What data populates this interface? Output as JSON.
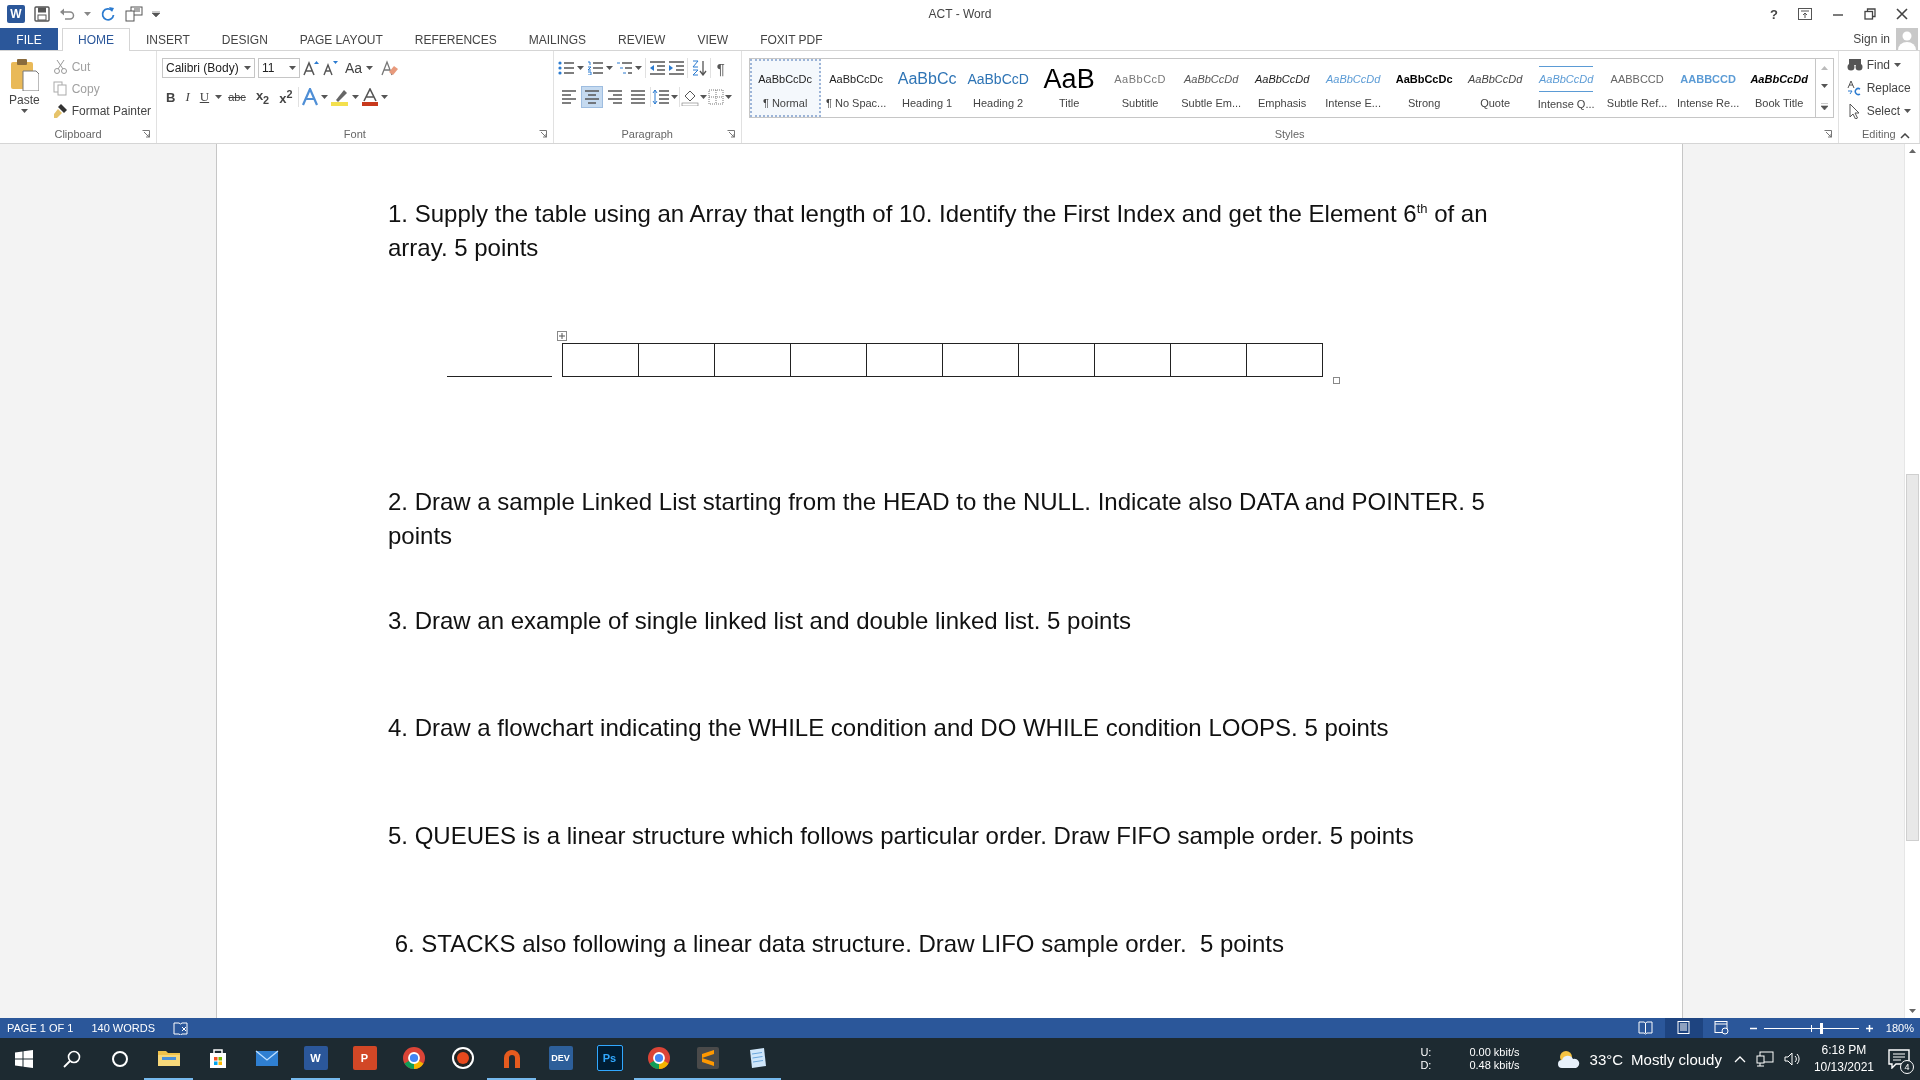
{
  "window": {
    "title": "ACT - Word",
    "app_letter": "W",
    "help": "?"
  },
  "ribbon_tabs": [
    {
      "label": "FILE",
      "kind": "file",
      "selected": false
    },
    {
      "label": "HOME",
      "kind": "tab",
      "selected": true
    },
    {
      "label": "INSERT",
      "kind": "tab",
      "selected": false
    },
    {
      "label": "DESIGN",
      "kind": "tab",
      "selected": false
    },
    {
      "label": "PAGE LAYOUT",
      "kind": "tab",
      "selected": false
    },
    {
      "label": "REFERENCES",
      "kind": "tab",
      "selected": false
    },
    {
      "label": "MAILINGS",
      "kind": "tab",
      "selected": false
    },
    {
      "label": "REVIEW",
      "kind": "tab",
      "selected": false
    },
    {
      "label": "VIEW",
      "kind": "tab",
      "selected": false
    },
    {
      "label": "FOXIT PDF",
      "kind": "tab",
      "selected": false
    }
  ],
  "account": {
    "label": "Sign in"
  },
  "clipboard": {
    "paste": "Paste",
    "group_label": "Clipboard",
    "items": [
      {
        "label": "Cut",
        "kind": "cut",
        "disabled": true
      },
      {
        "label": "Copy",
        "kind": "copy",
        "disabled": true
      },
      {
        "label": "Format Painter",
        "kind": "painter",
        "disabled": false
      }
    ]
  },
  "font": {
    "name": "Calibri (Body)",
    "size": "11",
    "case_button": "Aa",
    "group_label": "Font",
    "format_buttons": [
      {
        "label": "B",
        "kind": "bold"
      },
      {
        "label": "I",
        "kind": "italic"
      },
      {
        "label": "U",
        "kind": "underline"
      },
      {
        "label": "abc",
        "kind": "strike"
      },
      {
        "label": "x$_{2}$",
        "kind": "sub"
      },
      {
        "label": "x$^{2}$",
        "kind": "sup"
      }
    ]
  },
  "paragraph": {
    "marks_button": "¶",
    "group_label": "Paragraph",
    "alignments": [
      {
        "kind": "left",
        "selected": false
      },
      {
        "kind": "center",
        "selected": true
      },
      {
        "kind": "right",
        "selected": false
      },
      {
        "kind": "justify",
        "selected": false
      }
    ]
  },
  "styles": {
    "group_label": "Styles",
    "items": [
      {
        "preview": "AaBbCcDc",
        "label": "¶ Normal",
        "kind": "normal",
        "selected": true
      },
      {
        "preview": "AaBbCcDc",
        "label": "¶ No Spac...",
        "kind": "normal",
        "selected": false
      },
      {
        "preview": "AaBbCc",
        "label": "Heading 1",
        "kind": "heading1",
        "selected": false
      },
      {
        "preview": "AaBbCcD",
        "label": "Heading 2",
        "kind": "heading2",
        "selected": false
      },
      {
        "preview": "AaB",
        "label": "Title",
        "kind": "title",
        "selected": false
      },
      {
        "preview": "AaBbCcD",
        "label": "Subtitle",
        "kind": "subtitle",
        "selected": false
      },
      {
        "preview": "AaBbCcDd",
        "label": "Subtle Em...",
        "kind": "subtle",
        "selected": false
      },
      {
        "preview": "AaBbCcDd",
        "label": "Emphasis",
        "kind": "emphasis",
        "selected": false
      },
      {
        "preview": "AaBbCcDd",
        "label": "Intense E...",
        "kind": "intense",
        "selected": false
      },
      {
        "preview": "AaBbCcDc",
        "label": "Strong",
        "kind": "strong",
        "selected": false
      },
      {
        "preview": "AaBbCcDd",
        "label": "Quote",
        "kind": "quote",
        "selected": false
      },
      {
        "preview": "AaBbCcDd",
        "label": "Intense Q...",
        "kind": "intensequote",
        "selected": false
      },
      {
        "preview": "AABBCCD",
        "label": "Subtle Ref...",
        "kind": "subtleref",
        "selected": false
      },
      {
        "preview": "AABBCCD",
        "label": "Intense Re...",
        "kind": "intenseref",
        "selected": false
      },
      {
        "preview": "AaBbCcDd",
        "label": "Book Title",
        "kind": "booktitle",
        "selected": false
      }
    ]
  },
  "editing": {
    "group_label": "Editing",
    "items": [
      {
        "label": "Find",
        "kind": "find"
      },
      {
        "label": "Replace",
        "kind": "replace"
      },
      {
        "label": "Select",
        "kind": "select"
      }
    ]
  },
  "document": {
    "blocks": [
      {
        "kind": "question",
        "text": "1. Supply the table using an Array that length of 10. Identify the First Index and get the Element 6$^{th}$ of an array. 5 points"
      },
      {
        "kind": "answer_table"
      },
      {
        "kind": "question",
        "text": "2. Draw a sample Linked List starting from the HEAD to the NULL. Indicate also DATA and POINTER. 5 points"
      },
      {
        "kind": "question",
        "text": "3. Draw an example of single linked list and double linked list. 5 points"
      },
      {
        "kind": "question",
        "text": "4. Draw a flowchart indicating the WHILE condition and DO WHILE condition LOOPS. 5 points"
      },
      {
        "kind": "question",
        "text": "5. QUEUES is a linear structure which follows particular order. Draw FIFO sample order. 5 points"
      },
      {
        "kind": "question",
        "text": " 6. STACKS also following a linear data structure. Draw LIFO sample order.  5 points"
      }
    ]
  },
  "status_bar": {
    "page": "PAGE 1 OF 1",
    "words": "140 WORDS",
    "views": [
      {
        "kind": "read",
        "selected": false
      },
      {
        "kind": "print",
        "selected": true
      },
      {
        "kind": "web",
        "selected": false
      }
    ],
    "zoom": {
      "level": 0.6,
      "reading": "180%"
    }
  },
  "taskbar": {
    "apps": [
      {
        "kind": "explorer",
        "running": true
      },
      {
        "kind": "store",
        "running": false
      },
      {
        "kind": "mail",
        "running": false
      },
      {
        "kind": "word",
        "label": "W",
        "running": true
      },
      {
        "kind": "powerpoint",
        "label": "P",
        "running": false
      },
      {
        "kind": "chrome",
        "running": false
      },
      {
        "kind": "recorder",
        "running": false
      },
      {
        "kind": "arch",
        "running": true
      },
      {
        "kind": "dev",
        "label": "DEV",
        "running": false
      },
      {
        "kind": "photoshop",
        "label": "Ps",
        "running": false
      },
      {
        "kind": "chrome",
        "running": true
      },
      {
        "kind": "sublime",
        "running": true
      },
      {
        "kind": "notepad",
        "running": true
      }
    ],
    "network": [
      {
        "label": "U:",
        "value": "0.00 kbit/s"
      },
      {
        "label": "D:",
        "value": "0.48 kbit/s"
      }
    ],
    "weather": {
      "temperature": "33°C",
      "condition": "Mostly cloudy"
    },
    "time": "6:18 PM",
    "date": "10/13/2021",
    "notifications": "4"
  }
}
